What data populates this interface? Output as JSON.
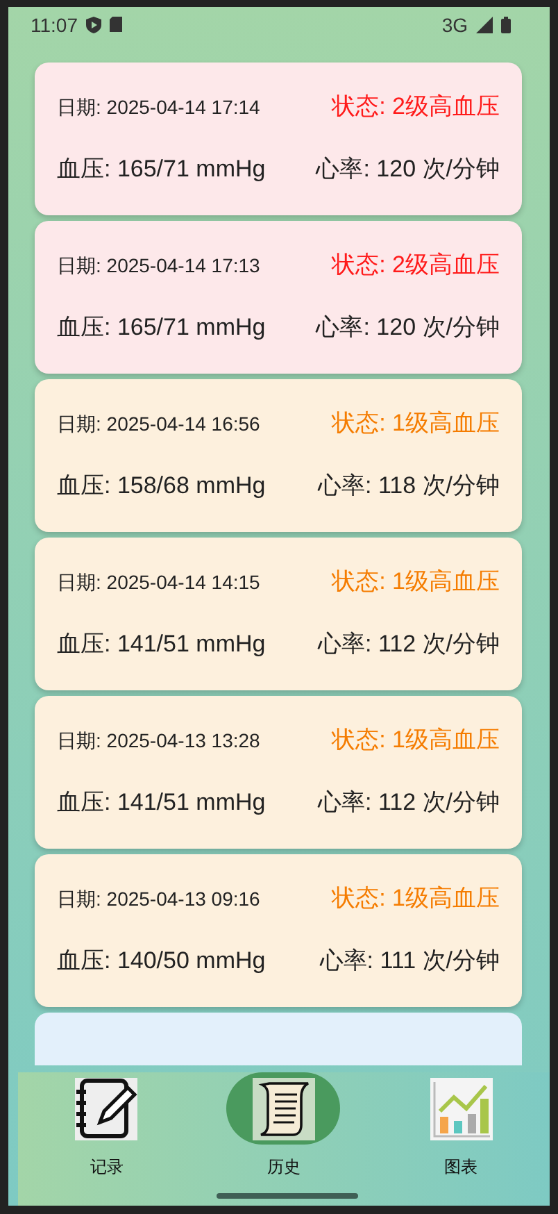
{
  "status_bar": {
    "time": "11:07",
    "network": "3G"
  },
  "records": [
    {
      "kind": "grade2",
      "date": "日期: 2025-04-14 17:14",
      "status": "状态: 2级高血压",
      "pressure": "血压: 165/71 mmHg",
      "heart_rate": "心率: 120 次/分钟"
    },
    {
      "kind": "grade2",
      "date": "日期: 2025-04-14 17:13",
      "status": "状态: 2级高血压",
      "pressure": "血压: 165/71 mmHg",
      "heart_rate": "心率: 120 次/分钟"
    },
    {
      "kind": "grade1",
      "date": "日期: 2025-04-14 16:56",
      "status": "状态: 1级高血压",
      "pressure": "血压: 158/68 mmHg",
      "heart_rate": "心率: 118 次/分钟"
    },
    {
      "kind": "grade1",
      "date": "日期: 2025-04-14 14:15",
      "status": "状态: 1级高血压",
      "pressure": "血压: 141/51 mmHg",
      "heart_rate": "心率: 112 次/分钟"
    },
    {
      "kind": "grade1",
      "date": "日期: 2025-04-13 13:28",
      "status": "状态: 1级高血压",
      "pressure": "血压: 141/51 mmHg",
      "heart_rate": "心率: 112 次/分钟"
    },
    {
      "kind": "grade1",
      "date": "日期: 2025-04-13 09:16",
      "status": "状态: 1级高血压",
      "pressure": "血压: 140/50 mmHg",
      "heart_rate": "心率: 111 次/分钟"
    },
    {
      "kind": "normal"
    }
  ],
  "nav": [
    {
      "kind": "record",
      "label": "记录",
      "selected": false
    },
    {
      "kind": "history",
      "label": "历史",
      "selected": true
    },
    {
      "kind": "chart",
      "label": "图表",
      "selected": false
    }
  ]
}
